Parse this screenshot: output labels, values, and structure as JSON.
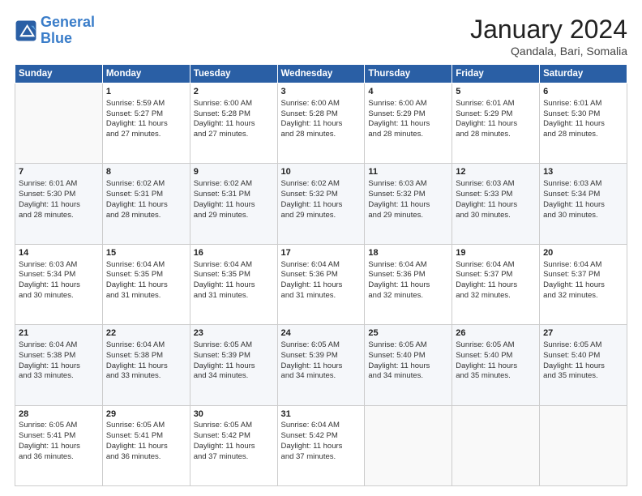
{
  "header": {
    "logo_line1": "General",
    "logo_line2": "Blue",
    "month": "January 2024",
    "location": "Qandala, Bari, Somalia"
  },
  "days_of_week": [
    "Sunday",
    "Monday",
    "Tuesday",
    "Wednesday",
    "Thursday",
    "Friday",
    "Saturday"
  ],
  "weeks": [
    [
      {
        "day": "",
        "info": ""
      },
      {
        "day": "1",
        "info": "Sunrise: 5:59 AM\nSunset: 5:27 PM\nDaylight: 11 hours\nand 27 minutes."
      },
      {
        "day": "2",
        "info": "Sunrise: 6:00 AM\nSunset: 5:28 PM\nDaylight: 11 hours\nand 27 minutes."
      },
      {
        "day": "3",
        "info": "Sunrise: 6:00 AM\nSunset: 5:28 PM\nDaylight: 11 hours\nand 28 minutes."
      },
      {
        "day": "4",
        "info": "Sunrise: 6:00 AM\nSunset: 5:29 PM\nDaylight: 11 hours\nand 28 minutes."
      },
      {
        "day": "5",
        "info": "Sunrise: 6:01 AM\nSunset: 5:29 PM\nDaylight: 11 hours\nand 28 minutes."
      },
      {
        "day": "6",
        "info": "Sunrise: 6:01 AM\nSunset: 5:30 PM\nDaylight: 11 hours\nand 28 minutes."
      }
    ],
    [
      {
        "day": "7",
        "info": "Sunrise: 6:01 AM\nSunset: 5:30 PM\nDaylight: 11 hours\nand 28 minutes."
      },
      {
        "day": "8",
        "info": "Sunrise: 6:02 AM\nSunset: 5:31 PM\nDaylight: 11 hours\nand 28 minutes."
      },
      {
        "day": "9",
        "info": "Sunrise: 6:02 AM\nSunset: 5:31 PM\nDaylight: 11 hours\nand 29 minutes."
      },
      {
        "day": "10",
        "info": "Sunrise: 6:02 AM\nSunset: 5:32 PM\nDaylight: 11 hours\nand 29 minutes."
      },
      {
        "day": "11",
        "info": "Sunrise: 6:03 AM\nSunset: 5:32 PM\nDaylight: 11 hours\nand 29 minutes."
      },
      {
        "day": "12",
        "info": "Sunrise: 6:03 AM\nSunset: 5:33 PM\nDaylight: 11 hours\nand 30 minutes."
      },
      {
        "day": "13",
        "info": "Sunrise: 6:03 AM\nSunset: 5:34 PM\nDaylight: 11 hours\nand 30 minutes."
      }
    ],
    [
      {
        "day": "14",
        "info": "Sunrise: 6:03 AM\nSunset: 5:34 PM\nDaylight: 11 hours\nand 30 minutes."
      },
      {
        "day": "15",
        "info": "Sunrise: 6:04 AM\nSunset: 5:35 PM\nDaylight: 11 hours\nand 31 minutes."
      },
      {
        "day": "16",
        "info": "Sunrise: 6:04 AM\nSunset: 5:35 PM\nDaylight: 11 hours\nand 31 minutes."
      },
      {
        "day": "17",
        "info": "Sunrise: 6:04 AM\nSunset: 5:36 PM\nDaylight: 11 hours\nand 31 minutes."
      },
      {
        "day": "18",
        "info": "Sunrise: 6:04 AM\nSunset: 5:36 PM\nDaylight: 11 hours\nand 32 minutes."
      },
      {
        "day": "19",
        "info": "Sunrise: 6:04 AM\nSunset: 5:37 PM\nDaylight: 11 hours\nand 32 minutes."
      },
      {
        "day": "20",
        "info": "Sunrise: 6:04 AM\nSunset: 5:37 PM\nDaylight: 11 hours\nand 32 minutes."
      }
    ],
    [
      {
        "day": "21",
        "info": "Sunrise: 6:04 AM\nSunset: 5:38 PM\nDaylight: 11 hours\nand 33 minutes."
      },
      {
        "day": "22",
        "info": "Sunrise: 6:04 AM\nSunset: 5:38 PM\nDaylight: 11 hours\nand 33 minutes."
      },
      {
        "day": "23",
        "info": "Sunrise: 6:05 AM\nSunset: 5:39 PM\nDaylight: 11 hours\nand 34 minutes."
      },
      {
        "day": "24",
        "info": "Sunrise: 6:05 AM\nSunset: 5:39 PM\nDaylight: 11 hours\nand 34 minutes."
      },
      {
        "day": "25",
        "info": "Sunrise: 6:05 AM\nSunset: 5:40 PM\nDaylight: 11 hours\nand 34 minutes."
      },
      {
        "day": "26",
        "info": "Sunrise: 6:05 AM\nSunset: 5:40 PM\nDaylight: 11 hours\nand 35 minutes."
      },
      {
        "day": "27",
        "info": "Sunrise: 6:05 AM\nSunset: 5:40 PM\nDaylight: 11 hours\nand 35 minutes."
      }
    ],
    [
      {
        "day": "28",
        "info": "Sunrise: 6:05 AM\nSunset: 5:41 PM\nDaylight: 11 hours\nand 36 minutes."
      },
      {
        "day": "29",
        "info": "Sunrise: 6:05 AM\nSunset: 5:41 PM\nDaylight: 11 hours\nand 36 minutes."
      },
      {
        "day": "30",
        "info": "Sunrise: 6:05 AM\nSunset: 5:42 PM\nDaylight: 11 hours\nand 37 minutes."
      },
      {
        "day": "31",
        "info": "Sunrise: 6:04 AM\nSunset: 5:42 PM\nDaylight: 11 hours\nand 37 minutes."
      },
      {
        "day": "",
        "info": ""
      },
      {
        "day": "",
        "info": ""
      },
      {
        "day": "",
        "info": ""
      }
    ]
  ]
}
